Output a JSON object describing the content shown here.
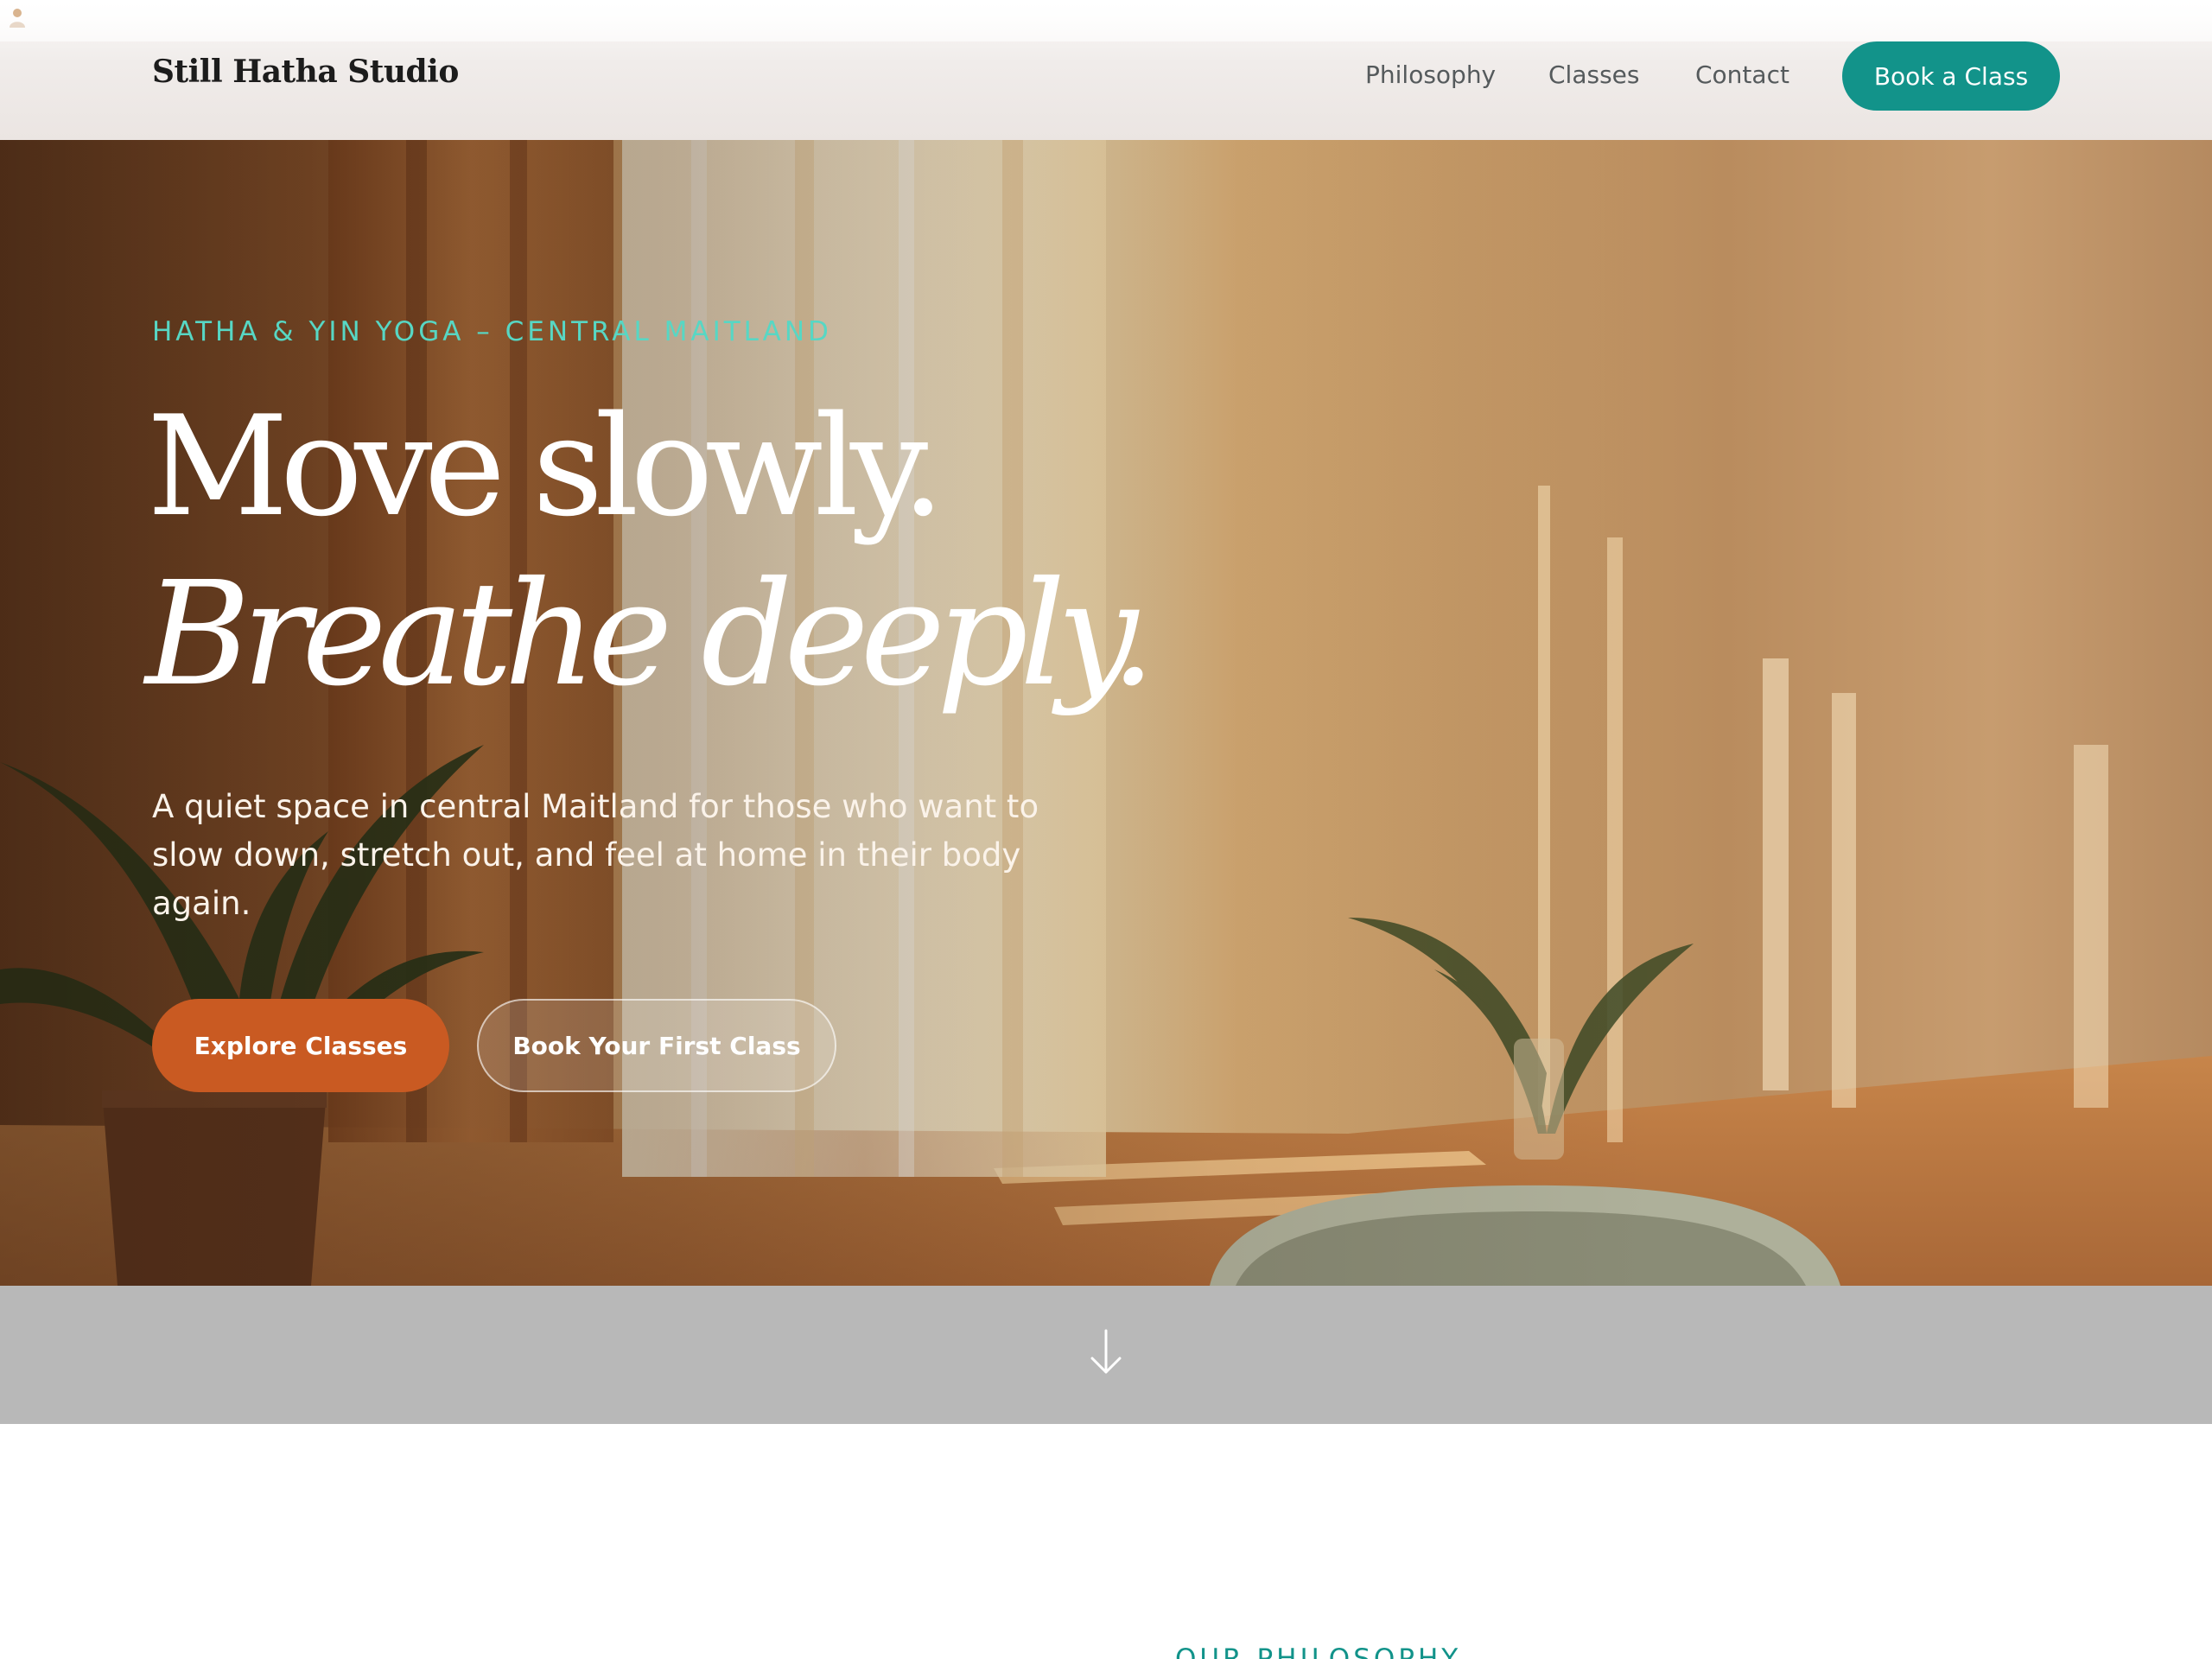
{
  "nav": {
    "brand": "Still Hatha Studio",
    "links": [
      "Philosophy",
      "Classes",
      "Contact"
    ],
    "cta": "Book a Class"
  },
  "hero": {
    "eyebrow": "HATHA & YIN YOGA – CENTRAL MAITLAND",
    "headline_line1": "Move slowly.",
    "headline_line2": "Breathe deeply.",
    "lead": "A quiet space in central Maitland for those who want to slow down, stretch out, and feel at home in their body again.",
    "primary_button": "Explore Classes",
    "secondary_button": "Book Your First Class"
  },
  "scroll_icon": "arrow-down-icon",
  "philosophy": {
    "eyebrow": "OUR PHILOSOPHY"
  },
  "colors": {
    "accent_teal": "#12938a",
    "eyebrow_teal": "#57d7c4",
    "primary_orange": "#c95a22"
  }
}
